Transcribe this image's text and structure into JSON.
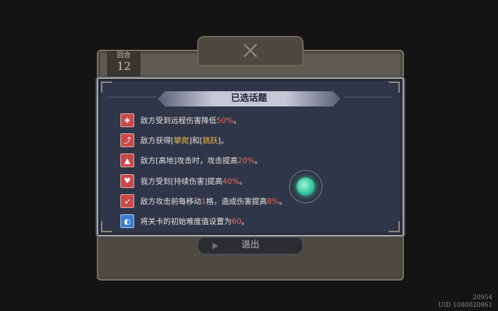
{
  "round": {
    "label": "回合",
    "value": "12"
  },
  "modal": {
    "title": "已选话题",
    "topics": [
      {
        "icon": "shield-icon",
        "color": "#c9494a",
        "parts": [
          "敌方受到远程伤害降低",
          "50%",
          "。"
        ],
        "styles": [
          "",
          "num",
          ""
        ]
      },
      {
        "icon": "climb-icon",
        "color": "#c9494a",
        "parts": [
          "敌方获得[",
          "攀爬",
          "]和[",
          "跳跃",
          "]。"
        ],
        "styles": [
          "",
          "key",
          "",
          "key",
          ""
        ]
      },
      {
        "icon": "highland-icon",
        "color": "#c9494a",
        "parts": [
          "敌方[高地]攻击时，攻击提高",
          "20%",
          "。"
        ],
        "styles": [
          "",
          "num",
          ""
        ]
      },
      {
        "icon": "heart-damage-icon",
        "color": "#c9494a",
        "parts": [
          "我方受到[持续伤害]提高",
          "40%",
          "。"
        ],
        "styles": [
          "",
          "num",
          ""
        ]
      },
      {
        "icon": "move-attack-icon",
        "color": "#c9494a",
        "parts": [
          "敌方攻击前每移动",
          "1",
          "格，造成伤害提高",
          "8%",
          "。"
        ],
        "styles": [
          "",
          "num",
          "",
          "num",
          ""
        ]
      },
      {
        "icon": "difficulty-icon",
        "color": "#3a7ed2",
        "parts": [
          "将关卡的初始难度值设置为",
          "60",
          "。"
        ],
        "styles": [
          "",
          "num",
          ""
        ]
      }
    ]
  },
  "exit_button": {
    "label": "退出"
  },
  "footer": {
    "code": "20954",
    "uid": "UID 1080020861"
  }
}
